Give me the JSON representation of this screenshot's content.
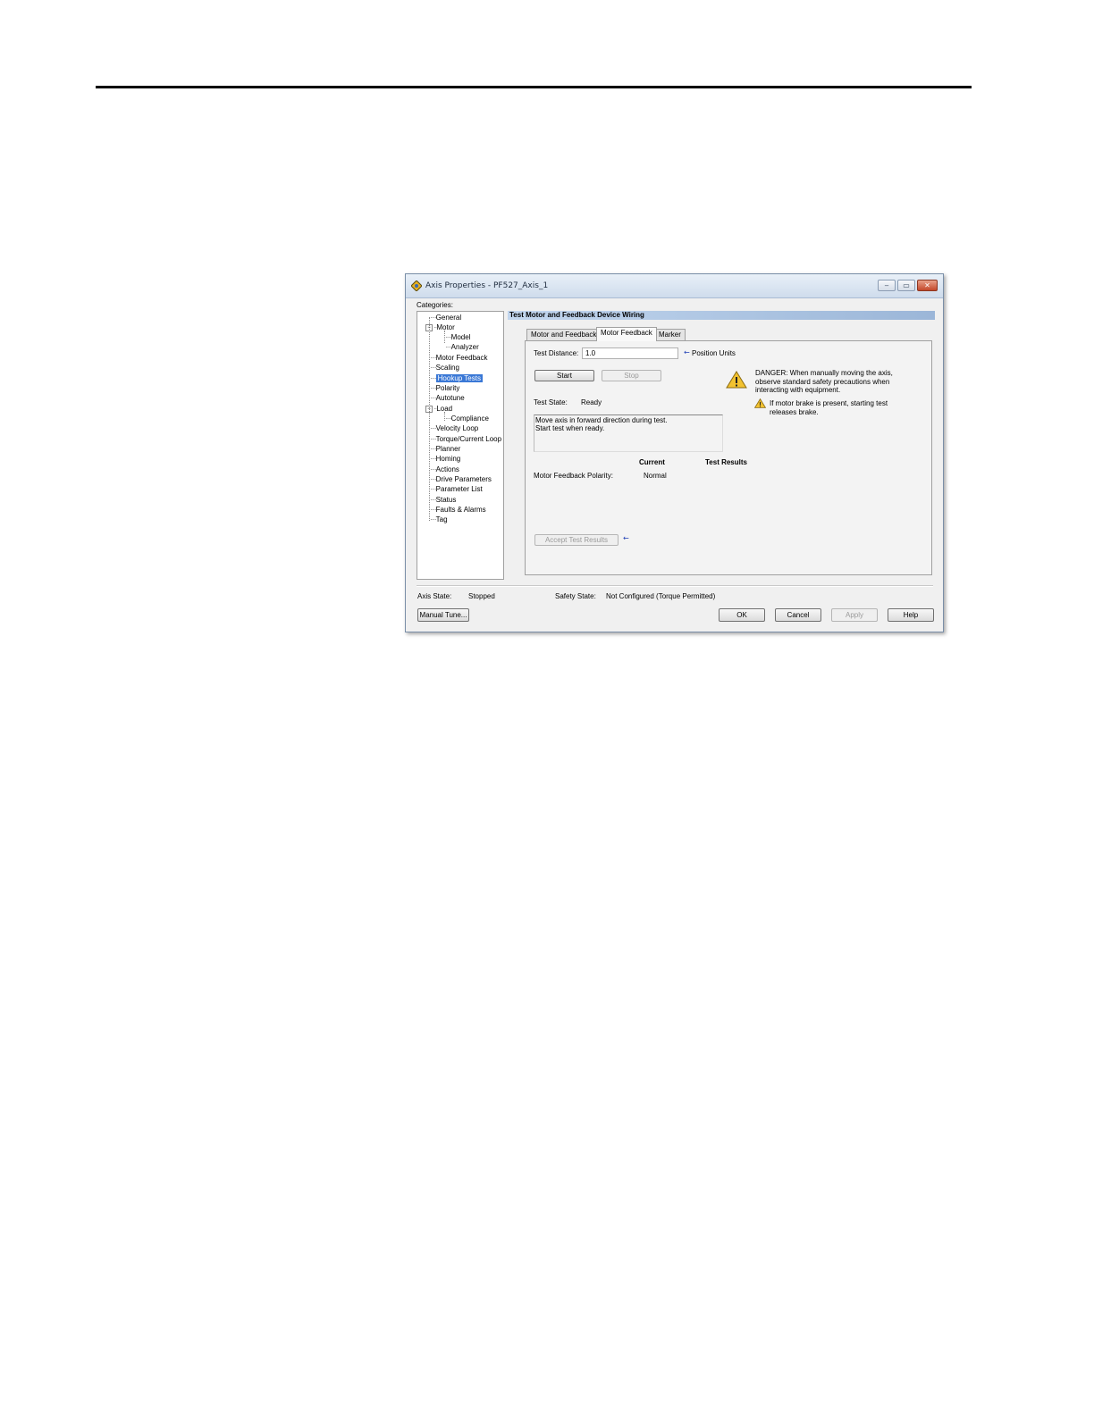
{
  "window": {
    "title": "Axis Properties - PF527_Axis_1",
    "controls": {
      "minimize": "‒",
      "maximize": "▭",
      "close": "✕"
    }
  },
  "categories": {
    "label": "Categories:",
    "items": [
      {
        "label": "General"
      },
      {
        "label": "Motor",
        "expander": "−"
      },
      {
        "label": "Model"
      },
      {
        "label": "Analyzer"
      },
      {
        "label": "Motor Feedback"
      },
      {
        "label": "Scaling"
      },
      {
        "label": "Hookup Tests",
        "selected": true
      },
      {
        "label": "Polarity"
      },
      {
        "label": "Autotune"
      },
      {
        "label": "Load",
        "expander": "−"
      },
      {
        "label": "Compliance"
      },
      {
        "label": "Velocity Loop"
      },
      {
        "label": "Torque/Current Loop"
      },
      {
        "label": "Planner"
      },
      {
        "label": "Homing"
      },
      {
        "label": "Actions"
      },
      {
        "label": "Drive Parameters"
      },
      {
        "label": "Parameter List"
      },
      {
        "label": "Status"
      },
      {
        "label": "Faults & Alarms"
      },
      {
        "label": "Tag"
      }
    ]
  },
  "section_title": "Test Motor and Feedback Device Wiring",
  "tabs": [
    {
      "label": "Motor and Feedback"
    },
    {
      "label": "Motor Feedback",
      "active": true
    },
    {
      "label": "Marker"
    }
  ],
  "test": {
    "distance_label": "Test Distance:",
    "distance_value": "1.0",
    "units_label": "Position Units",
    "indicator": "←",
    "start_label": "Start",
    "stop_label": "Stop",
    "state_label": "Test State:",
    "state_value": "Ready",
    "message_line1": "Move axis in forward direction during test.",
    "message_line2": "Start test when ready.",
    "current_header": "Current",
    "results_header": "Test Results",
    "polarity_label": "Motor Feedback Polarity:",
    "polarity_current": "Normal",
    "accept_label": "Accept Test Results"
  },
  "warnings": {
    "danger_line1": "DANGER: When manually moving the axis,",
    "danger_line2": "observe standard safety precautions when",
    "danger_line3": "interacting with equipment.",
    "brake_line1": "If motor brake is present, starting test",
    "brake_line2": "releases brake."
  },
  "status": {
    "axis_state_label": "Axis State:",
    "axis_state_value": "Stopped",
    "safety_state_label": "Safety State:",
    "safety_state_value": "Not Configured (Torque Permitted)"
  },
  "footer": {
    "manual_tune": "Manual Tune...",
    "ok": "OK",
    "cancel": "Cancel",
    "apply": "Apply",
    "help": "Help"
  }
}
